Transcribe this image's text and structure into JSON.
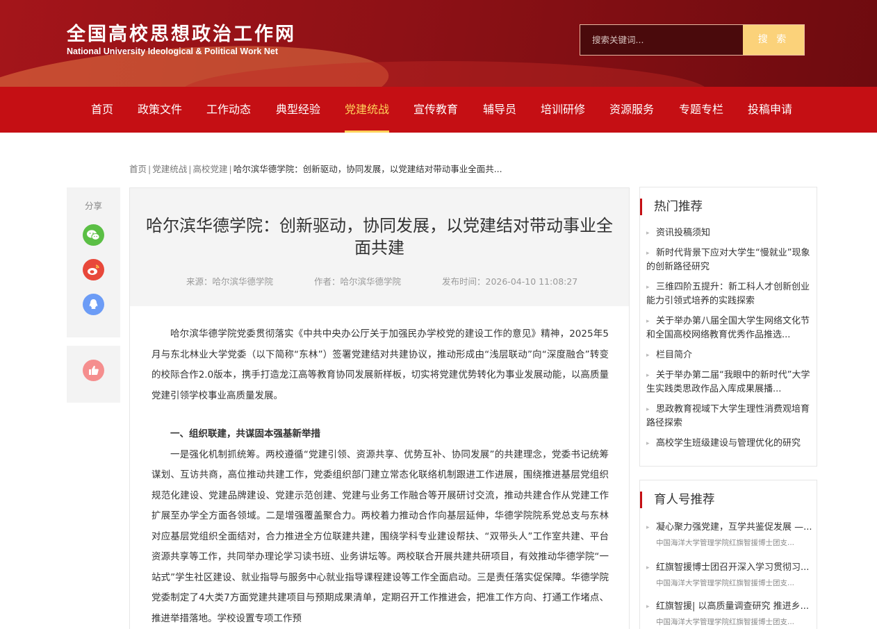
{
  "header": {
    "logo_cn": "全国高校思想政治工作网",
    "logo_en": "National University Ideological & Political Work Net",
    "search_placeholder": "搜索关键词...",
    "search_button": "搜 索"
  },
  "nav": {
    "items": [
      "首页",
      "政策文件",
      "工作动态",
      "典型经验",
      "党建统战",
      "宣传教育",
      "辅导员",
      "培训研修",
      "资源服务",
      "专题专栏",
      "投稿申请"
    ],
    "active_index": 4
  },
  "breadcrumb": {
    "items": [
      "首页",
      "党建统战",
      "高校党建"
    ],
    "current": "哈尔滨华德学院：创新驱动，协同发展，以党建结对带动事业全面共..."
  },
  "share": {
    "label": "分享",
    "icons": [
      "wechat-icon",
      "weibo-icon",
      "qq-icon"
    ],
    "like_icon": "thumbs-up-icon"
  },
  "article": {
    "title": "哈尔滨华德学院：创新驱动，协同发展，以党建结对带动事业全面共建",
    "source": "来源：哈尔滨华德学院",
    "author": "作者：哈尔滨华德学院",
    "published": "发布时间：2026-04-10 11:08:27",
    "paragraph1": "哈尔滨华德学院党委贯彻落实《中共中央办公厅关于加强民办学校党的建设工作的意见》精神，2025年5月与东北林业大学党委（以下简称“东林”）签署党建结对共建协议，推动形成由“浅层联动”向“深度融合”转变的校际合作2.0版本，携手打造龙江高等教育协同发展新样板，切实将党建优势转化为事业发展动能，以高质量党建引领学校事业高质量发展。",
    "section1_heading": "一、组织联建，共谋固本强基新举措",
    "paragraph2": "一是强化机制抓统筹。两校遵循“党建引领、资源共享、优势互补、协同发展”的共建理念，党委书记统筹谋划、互访共商，高位推动共建工作，党委组织部门建立常态化联络机制跟进工作进展，围绕推进基层党组织规范化建设、党建品牌建设、党建示范创建、党建与业务工作融合等开展研讨交流，推动共建合作从党建工作扩展至办学全方面各领域。二是增强覆盖聚合力。两校着力推动合作向基层延伸，华德学院院系党总支与东林对应基层党组织全面结对，合力推进全方位联建共建，围绕学科专业建设帮扶、“双带头人”工作室共建、平台资源共享等工作，共同举办理论学习读书班、业务讲坛等。两校联合开展共建共研项目，有效推动华德学院“一站式”学生社区建设、就业指导与服务中心就业指导课程建设等工作全面启动。三是责任落实促保障。华德学院党委制定了4大类7方面党建共建项目与预期成果清单，定期召开工作推进会，把准工作方向、打通工作堵点、推进举措落地。学校设置专项工作预"
  },
  "hot": {
    "title": "热门推荐",
    "items": [
      "资讯投稿须知",
      "新时代背景下应对大学生“慢就业”现象的创新路径研究",
      "三维四阶五提升：新工科人才创新创业能力引领式培养的实践探索",
      "关于举办第八届全国大学生网络文化节和全国高校网络教育优秀作品推选...",
      "栏目简介",
      "关于举办第二届“我眼中的新时代”大学生实践类思政作品入库成果展播...",
      "思政教育视域下大学生理性消费观培育路径探索",
      "高校学生班级建设与管理优化的研究"
    ]
  },
  "yuren": {
    "title": "育人号推荐",
    "items": [
      {
        "title": "凝心聚力强党建，互学共鉴促发展 —...",
        "source": "中国海洋大学管理学院红旗智援博士团支..."
      },
      {
        "title": "红旗智援博士团召开深入学习贯彻习...",
        "source": "中国海洋大学管理学院红旗智援博士团支..."
      },
      {
        "title": "红旗智援| 以高质量调查研究 推进乡...",
        "source": "中国海洋大学管理学院红旗智援博士团支..."
      }
    ]
  },
  "colors": {
    "brand_red": "#c50f14",
    "header_red": "#8e1116",
    "accent_gold": "#ffd25a",
    "search_button": "#fbd27a"
  }
}
